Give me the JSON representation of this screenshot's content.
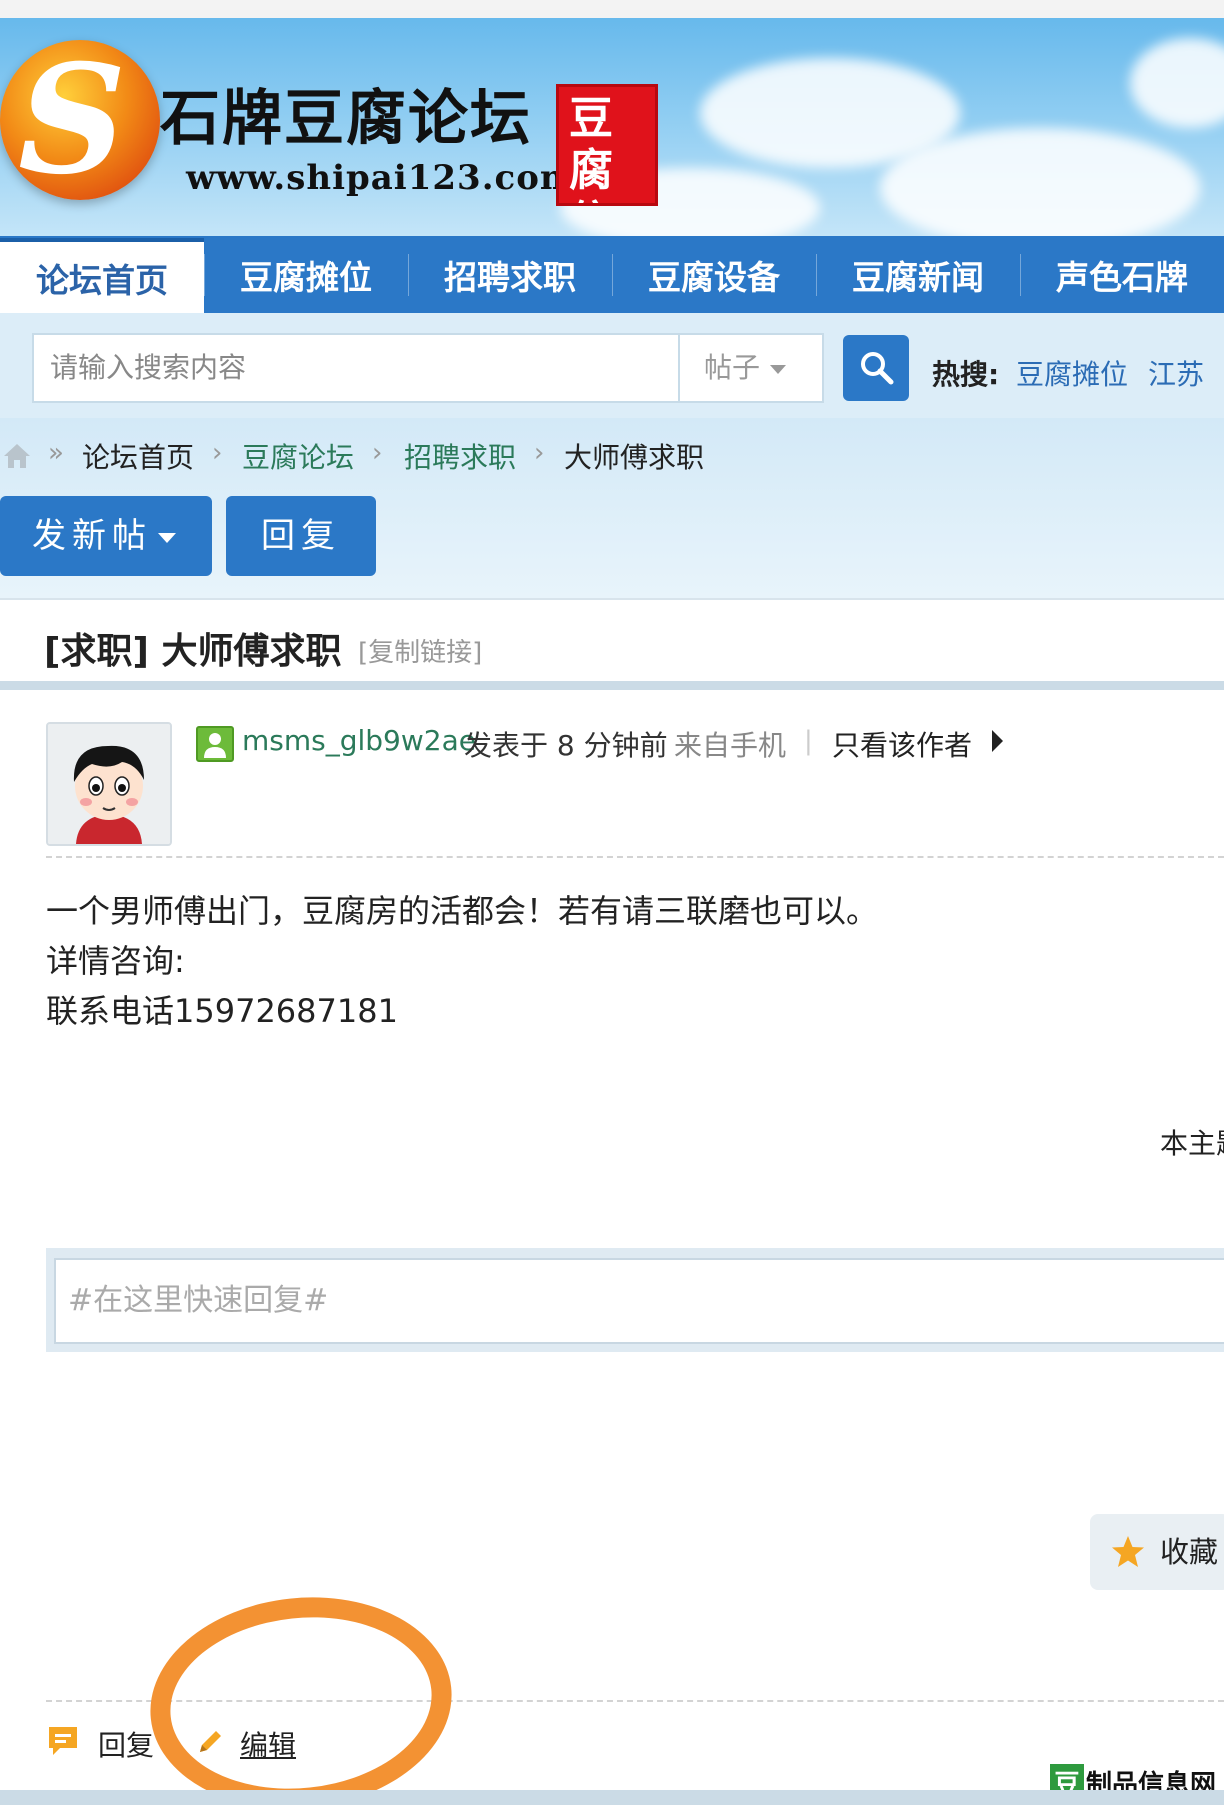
{
  "header": {
    "site_title": "石牌豆腐论坛",
    "site_url": "www.shipai123.com",
    "seal_text": "豆腐信息"
  },
  "nav": {
    "items": [
      {
        "label": "论坛首页",
        "active": true
      },
      {
        "label": "豆腐摊位"
      },
      {
        "label": "招聘求职"
      },
      {
        "label": "豆腐设备"
      },
      {
        "label": "豆腐新闻"
      },
      {
        "label": "声色石牌"
      }
    ]
  },
  "search": {
    "placeholder": "请输入搜索内容",
    "type_value": "帖子",
    "hot_label": "热搜:",
    "hot_items": [
      "豆腐摊位",
      "江苏"
    ]
  },
  "breadcrumb": {
    "items": [
      "论坛首页",
      "豆腐论坛",
      "招聘求职",
      "大师傅求职"
    ],
    "separator_first": "»",
    "separator": "›"
  },
  "actions": {
    "new_post": "发新帖",
    "reply": "回复"
  },
  "thread": {
    "title": "[求职] 大师傅求职",
    "copy_link": "[复制链接]"
  },
  "post": {
    "author": "msms_glb9w2ae",
    "posted": "发表于 8 分钟前",
    "source": "来自手机",
    "meta_sep": "|",
    "only_author": "只看该作者",
    "lines": [
      "一个男师傅出门，豆腐房的活都会！若有请三联磨也可以。",
      "详情咨询:",
      "联系电话15972687181"
    ],
    "side_note": "本主题"
  },
  "quick_reply": {
    "placeholder": "#在这里快速回复#"
  },
  "favorite": {
    "label": "收藏"
  },
  "bottom": {
    "reply": "回复",
    "edit": "编辑"
  },
  "watermark": {
    "badge": "豆",
    "text": "制品信息网"
  },
  "colors": {
    "nav_blue": "#2b78c7",
    "link_blue": "#2b6cb5",
    "author_green": "#2b7a5a",
    "annotation_orange": "#f39233",
    "seal_red": "#e0121b"
  }
}
